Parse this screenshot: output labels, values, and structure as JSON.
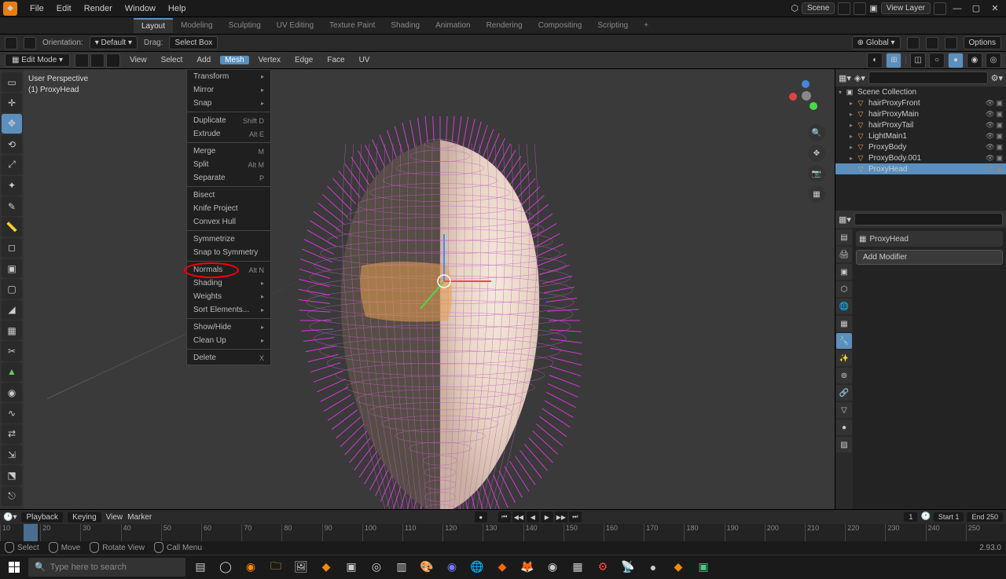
{
  "topmenu": {
    "items": [
      "File",
      "Edit",
      "Render",
      "Window",
      "Help"
    ],
    "workspaces": [
      "Layout",
      "Modeling",
      "Sculpting",
      "UV Editing",
      "Texture Paint",
      "Shading",
      "Animation",
      "Rendering",
      "Compositing",
      "Scripting"
    ],
    "active_ws": 0,
    "scene_label": "Scene",
    "viewlayer_label": "View Layer"
  },
  "toolrow": {
    "orientation_label": "Orientation:",
    "default_label": "Default",
    "drag_label": "Drag:",
    "select_box": "Select Box",
    "global": "Global",
    "options": "Options"
  },
  "moderow": {
    "mode": "Edit Mode",
    "menus": [
      "View",
      "Select",
      "Add",
      "Mesh",
      "Vertex",
      "Edge",
      "Face",
      "UV"
    ],
    "active_menu": 3
  },
  "viewport": {
    "line1": "User Perspective",
    "line2": "(1) ProxyHead"
  },
  "mesh_menu": {
    "items": [
      {
        "label": "Transform",
        "sub": true
      },
      {
        "label": "Mirror",
        "sub": true
      },
      {
        "label": "Snap",
        "sub": true
      },
      {
        "sep": true
      },
      {
        "label": "Duplicate",
        "shortcut": "Shift D"
      },
      {
        "label": "Extrude",
        "shortcut": "Alt E",
        "sub": true
      },
      {
        "sep": true
      },
      {
        "label": "Merge",
        "shortcut": "M",
        "sub": true
      },
      {
        "label": "Split",
        "shortcut": "Alt M",
        "sub": true
      },
      {
        "label": "Separate",
        "shortcut": "P",
        "sub": true
      },
      {
        "sep": true
      },
      {
        "label": "Bisect"
      },
      {
        "label": "Knife Project"
      },
      {
        "label": "Convex Hull"
      },
      {
        "sep": true
      },
      {
        "label": "Symmetrize"
      },
      {
        "label": "Snap to Symmetry"
      },
      {
        "sep": true
      },
      {
        "label": "Normals",
        "shortcut": "Alt N",
        "sub": true,
        "circled": true
      },
      {
        "label": "Shading",
        "sub": true
      },
      {
        "label": "Weights",
        "sub": true
      },
      {
        "label": "Sort Elements...",
        "sub": true
      },
      {
        "sep": true
      },
      {
        "label": "Show/Hide",
        "sub": true
      },
      {
        "label": "Clean Up",
        "sub": true
      },
      {
        "sep": true
      },
      {
        "label": "Delete",
        "shortcut": "X",
        "sub": true
      }
    ]
  },
  "outliner": {
    "root": "Scene Collection",
    "items": [
      {
        "name": "hairProxyFront",
        "type": "mesh"
      },
      {
        "name": "hairProxyMain",
        "type": "mesh"
      },
      {
        "name": "hairProxyTail",
        "type": "mesh"
      },
      {
        "name": "LightMain1",
        "type": "light"
      },
      {
        "name": "ProxyBody",
        "type": "mesh"
      },
      {
        "name": "ProxyBody.001",
        "type": "mesh"
      },
      {
        "name": "ProxyHead",
        "type": "mesh",
        "selected": true
      }
    ]
  },
  "props": {
    "object": "ProxyHead",
    "add_mod": "Add Modifier"
  },
  "timeline": {
    "playback": "Playback",
    "keying": "Keying",
    "view": "View",
    "marker": "Marker",
    "frame": "1",
    "start_label": "Start",
    "start": "1",
    "end_label": "End",
    "end": "250",
    "ticks": [
      "10",
      "20",
      "30",
      "40",
      "50",
      "60",
      "70",
      "80",
      "90",
      "100",
      "110",
      "120",
      "130",
      "140",
      "150",
      "160",
      "170",
      "180",
      "190",
      "200",
      "210",
      "220",
      "230",
      "240",
      "250"
    ]
  },
  "status": {
    "select": "Select",
    "move": "Move",
    "rotate": "Rotate View",
    "menu": "Call Menu",
    "version": "2.93.0"
  },
  "taskbar": {
    "search": "Type here to search"
  },
  "chart_data": {
    "type": "table",
    "note": "No chart data — 3D app UI"
  }
}
